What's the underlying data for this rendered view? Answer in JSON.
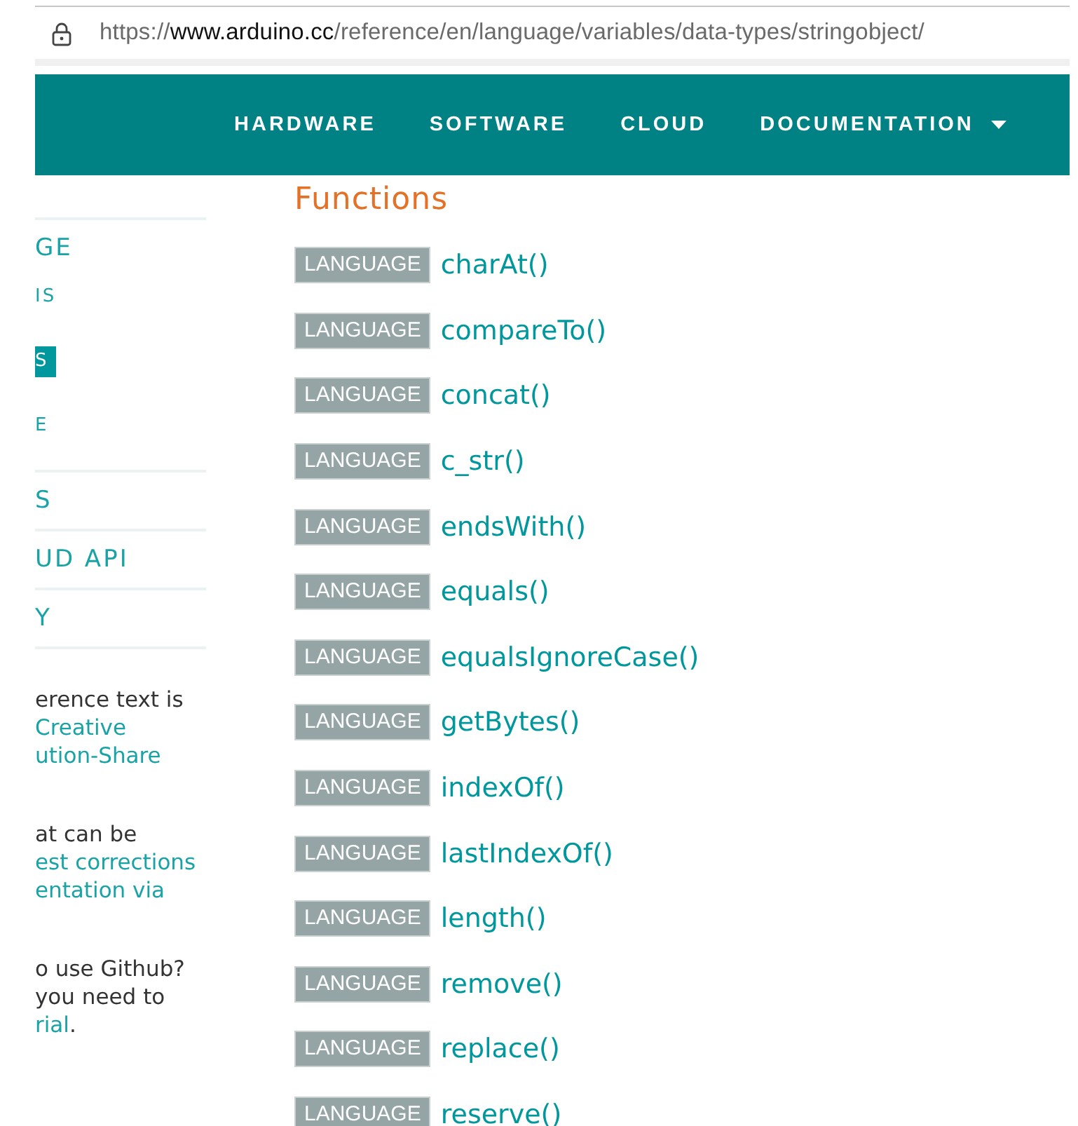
{
  "address_bar": {
    "url_parts": [
      {
        "text": "https://",
        "kind": "scheme"
      },
      {
        "text": "www.arduino.cc",
        "kind": "host"
      },
      {
        "text": "/reference/en/language/variables/data-types/stringobject/",
        "kind": "path"
      }
    ]
  },
  "nav": {
    "items": [
      {
        "label": "HARDWARE",
        "dropdown": false
      },
      {
        "label": "SOFTWARE",
        "dropdown": false
      },
      {
        "label": "CLOUD",
        "dropdown": false
      },
      {
        "label": "DOCUMENTATION",
        "dropdown": true
      }
    ]
  },
  "sidebar": {
    "items": [
      {
        "label": "GE",
        "children": [
          {
            "label": "IS",
            "selected": false
          },
          {
            "label": "S",
            "selected": true
          },
          {
            "label": "E",
            "selected": false
          }
        ]
      },
      {
        "label": "S"
      },
      {
        "label": "UD API"
      },
      {
        "label": "Y"
      }
    ],
    "notes": [
      [
        {
          "text": "erence text is",
          "link": false
        },
        {
          "text": "Creative",
          "link": true
        },
        {
          "text": "ution-Share",
          "link": true
        }
      ],
      [
        {
          "text": "at can be",
          "link": false
        },
        {
          "text": "est corrections",
          "link": true
        },
        {
          "text": "entation via",
          "link": true
        }
      ],
      [
        {
          "text": "o use Github?",
          "link": false
        },
        {
          "text": "you need to",
          "link": false
        },
        {
          "text": "rial",
          "link": true,
          "after": "."
        }
      ]
    ]
  },
  "main": {
    "heading": "Functions",
    "functions": [
      {
        "tag": "LANGUAGE",
        "name": "charAt()"
      },
      {
        "tag": "LANGUAGE",
        "name": "compareTo()"
      },
      {
        "tag": "LANGUAGE",
        "name": "concat()"
      },
      {
        "tag": "LANGUAGE",
        "name": "c_str()"
      },
      {
        "tag": "LANGUAGE",
        "name": "endsWith()"
      },
      {
        "tag": "LANGUAGE",
        "name": "equals()"
      },
      {
        "tag": "LANGUAGE",
        "name": "equalsIgnoreCase()"
      },
      {
        "tag": "LANGUAGE",
        "name": "getBytes()"
      },
      {
        "tag": "LANGUAGE",
        "name": "indexOf()"
      },
      {
        "tag": "LANGUAGE",
        "name": "lastIndexOf()"
      },
      {
        "tag": "LANGUAGE",
        "name": "length()"
      },
      {
        "tag": "LANGUAGE",
        "name": "remove()"
      },
      {
        "tag": "LANGUAGE",
        "name": "replace()"
      },
      {
        "tag": "LANGUAGE",
        "name": "reserve()"
      }
    ]
  }
}
